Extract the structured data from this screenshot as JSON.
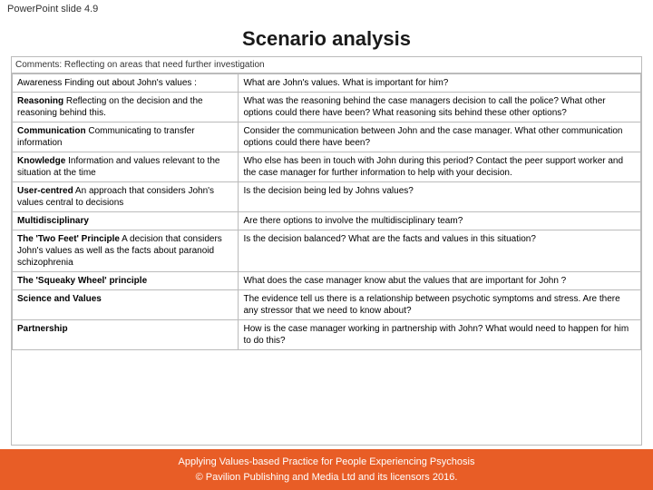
{
  "slide_label": "PowerPoint slide 4.9",
  "title": "Scenario analysis",
  "comments_label": "Comments: Reflecting on areas that need further investigation",
  "rows": [
    {
      "col1": "Awareness  Finding out about John's values :",
      "col1_bold": "",
      "col2": "What are John's values. What is important for him?"
    },
    {
      "col1_bold": "Reasoning",
      "col1": "  Reflecting on the decision and the reasoning behind this.",
      "col2": "What was the reasoning behind the case managers decision to call the police? What other options could there have been? What reasoning sits behind these other options?"
    },
    {
      "col1_bold": "Communication",
      "col1": "  Communicating to transfer information",
      "col2": "Consider the communication between John and the case manager. What other communication options could there have been?"
    },
    {
      "col1_bold": "Knowledge",
      "col1": "  Information and values relevant to the situation at the time",
      "col2": "Who else has been in touch with John during this period? Contact the peer support worker and the case manager for further information to help with your decision."
    },
    {
      "col1_bold": "User-centred",
      "col1": "  An approach that considers John's values central to decisions",
      "col2": "Is the decision being led by Johns values?"
    },
    {
      "col1_bold": "Multidisciplinary",
      "col1": "",
      "col2": "Are there options to involve the multidisciplinary team?"
    },
    {
      "col1_bold": "The 'Two Feet' Principle",
      "col1": "  A decision that considers John's values as well as the facts about paranoid schizophrenia",
      "col2": "Is the decision balanced? What are the facts and values in this situation?"
    },
    {
      "col1_bold": "The 'Squeaky Wheel' principle",
      "col1": "",
      "col2": "What does the case manager know abut the values that are important for John ?"
    },
    {
      "col1_bold": "Science and Values",
      "col1": "",
      "col2": "The evidence tell us there is a relationship between psychotic symptoms and stress. Are there any stressor that we need to know about?"
    },
    {
      "col1_bold": "Partnership",
      "col1": "",
      "col2": "How is the case manager working in partnership with John? What would need to happen for him to do this?"
    }
  ],
  "footer_line1": "Applying Values-based Practice for People Experiencing Psychosis",
  "footer_line2": "© Pavilion Publishing and Media Ltd and its licensors 2016."
}
